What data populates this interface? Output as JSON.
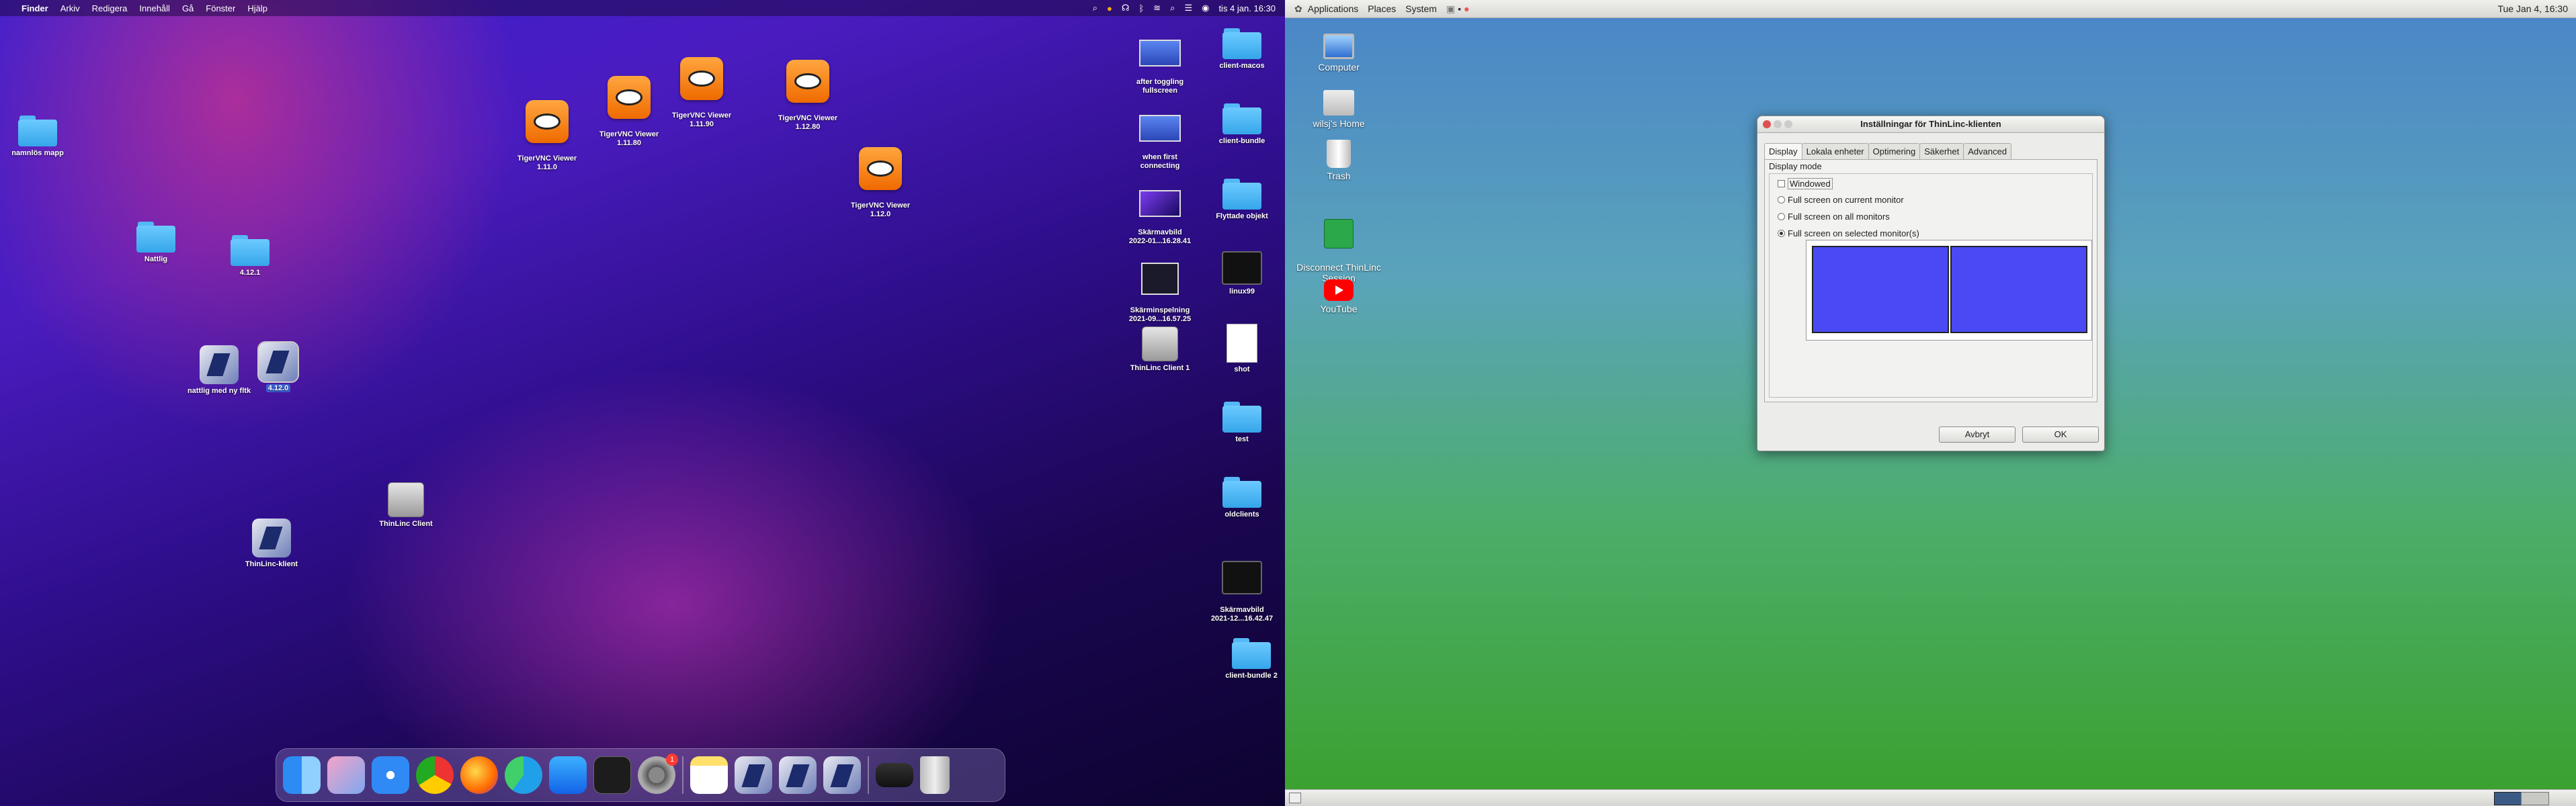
{
  "mac": {
    "menubar": {
      "app": "Finder",
      "items": [
        "Arkiv",
        "Redigera",
        "Innehåll",
        "Gå",
        "Fönster",
        "Hjälp"
      ],
      "clock": "tis 4 jan.  16:30"
    },
    "desktop": {
      "namnlos": "namnlös mapp",
      "nattlig": "Nattlig",
      "v4121": "4.12.1",
      "nattlig_ny": "nattlig med ny fltk",
      "v4120": "4.12.0",
      "thinlinc_client": "ThinLinc Client",
      "thinlinc_klient": "ThinLinc-klient",
      "tiger_1110": "TigerVNC Viewer\n1.11.0",
      "tiger_11180": "TigerVNC Viewer\n1.11.80",
      "tiger_11190": "TigerVNC Viewer\n1.11.90",
      "tiger_11280": "TigerVNC Viewer\n1.12.80",
      "tiger_1120": "TigerVNC Viewer\n1.12.0",
      "after_toggle": "after toggling\nfullscreen",
      "client_macos": "client-macos",
      "when_first": "when first\nconnecting",
      "client_bundle": "client-bundle",
      "skarmavbild1": "Skärmavbild\n2022-01...16.28.41",
      "flyttade": "Flyttade objekt",
      "skarminspelning": "Skärminspelning\n2021-09...16.57.25",
      "linux99": "linux99",
      "thinlinc_client1": "ThinLinc Client 1",
      "shot": "shot",
      "test": "test",
      "oldclients": "oldclients",
      "skarmavbild2": "Skärmavbild\n2021-12...16.42.47",
      "client_bundle2": "client-bundle 2"
    },
    "dock_badge": "1"
  },
  "linux": {
    "panel": {
      "menus": [
        "Applications",
        "Places",
        "System"
      ],
      "clock": "Tue Jan  4, 16:30"
    },
    "desktop": {
      "computer": "Computer",
      "home": "wilsj's Home",
      "trash": "Trash",
      "disconnect": "Disconnect ThinLinc\nSession",
      "youtube": "YouTube"
    },
    "dialog": {
      "title": "Inställningar för ThinLinc-klienten",
      "tabs": [
        "Display",
        "Lokala enheter",
        "Optimering",
        "Säkerhet",
        "Advanced"
      ],
      "group_label": "Display mode",
      "options": [
        "Windowed",
        "Full screen on current monitor",
        "Full screen on all monitors",
        "Full screen on selected monitor(s)"
      ],
      "selected_index": 3,
      "cancel": "Avbryt",
      "ok": "OK"
    }
  },
  "colors": {
    "monitor_fill": "#4a4af4",
    "mac_folder": "#4ab4f5"
  }
}
